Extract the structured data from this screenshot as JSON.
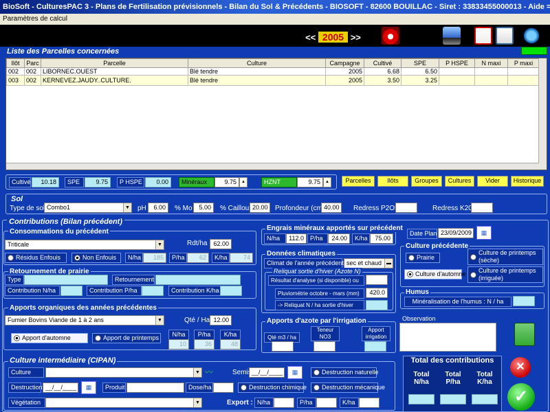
{
  "window": {
    "title": "BioSoft - CulturesPAC 3 - Plans de Fertilisation prévisionnels - Bilan du Sol & Précédents   -  BIOSOFT - 82600 BOUILLAC - Siret : 33833455000013 - Aide =..."
  },
  "menu": {
    "item": "Paramètres de calcul"
  },
  "year": {
    "prev": "<<",
    "value": "2005",
    "next": ">>"
  },
  "parcelles": {
    "title": "Liste des Parcelles concernées",
    "columns": [
      "Ilôt",
      "Parc",
      "Parcelle",
      "Culture",
      "Campagne",
      "Cultivé",
      "SPE",
      "P HSPE",
      "N maxi",
      "P maxi"
    ],
    "rows": [
      [
        "002",
        "002",
        "LIBORNEC.OUEST",
        "Blé tendre",
        "2005",
        "6.68",
        "6.50",
        "",
        "",
        ""
      ],
      [
        "003",
        "002",
        "KERNEVEZ.JAUDY..CULTURE.",
        "Blé tendre",
        "2005",
        "3.50",
        "3.25",
        "",
        "",
        ""
      ]
    ]
  },
  "totals": {
    "cultive_label": "Cultivé",
    "cultive": "10.18",
    "spe_label": "SPE",
    "spe": "9.75",
    "phspe_label": "P HSPE",
    "phspe": "0.00",
    "mineraux_label": "Minéraux",
    "mineraux": "9.75",
    "hznt_label": "HZNT",
    "hznt": "9.75"
  },
  "buttons": {
    "parcelles": "Parcelles",
    "ilots": "Ilôts",
    "groupes": "Groupes",
    "cultures": "Cultures",
    "vider": "Vider",
    "historique": "Historique"
  },
  "sol": {
    "title": "Sol",
    "type_label": "Type de sol",
    "type_value": "Combo1",
    "ph_label": "pH",
    "ph": "6.00",
    "mo_label": "% Mo",
    "mo": "5.00",
    "cailloux_label": "% Cailloux",
    "cailloux": "20.00",
    "profondeur_label": "Profondeur (cm)",
    "profondeur": "40.00",
    "redress_p_label": "Redress P2O5",
    "redress_p": "",
    "redress_k_label": "Redress K20",
    "redress_k": ""
  },
  "contributions": {
    "title": "Contributions (Bilan précédent)"
  },
  "precedent": {
    "title": "Consommations du précédent",
    "culture": "Triticale",
    "rdt_label": "Rdt/ha",
    "rdt": "62.00",
    "residus": "Résidus Enfouis",
    "non_enfouis": "Non Enfouis",
    "nha_label": "N/ha",
    "nha": "185",
    "pha_label": "P/ha",
    "pha": "62",
    "kha_label": "K/ha",
    "kha": "74"
  },
  "retournement": {
    "title": "Retournement de prairie",
    "type_label": "Type",
    "retour_label": "Retournement",
    "contrib_n": "Contribution N/ha",
    "contrib_p": "Contribution P/ha",
    "contrib_k": "Contribution K/ha"
  },
  "organiques": {
    "title": "Apports organiques des années précédentes",
    "produit": "Fumier Bovins Viande de 1 à 2 ans",
    "qte_label": "Qté / Ha",
    "qte": "12.00",
    "automne": "Apport d'automne",
    "printemps": "Apport de printemps",
    "nha_label": "N/ha",
    "nha": "10",
    "pha_label": "P/ha",
    "pha": "36",
    "kha_label": "K/ha",
    "kha": "48"
  },
  "engrais": {
    "title": "Engrais minéraux apportés sur précédent",
    "nha_label": "N/ha",
    "nha": "112.0",
    "pha_label": "P/ha",
    "pha": "24.00",
    "kha_label": "K/ha",
    "kha": "75.00"
  },
  "climat": {
    "title": "Données climatiques",
    "climat_label": "Climat de l'année précédente",
    "climat_value": "sec et chaud",
    "reliquat_title": "Reliquat sortie d'hiver (Azote N)",
    "analyse_label": "Résultat d'analyse (si disponible) ou",
    "analyse": "",
    "pluvio_label": "Pluviométrie octobre - mars (mm)",
    "pluvio": "420.0",
    "reliquat_label": "-> Reliquat N / ha sortie d'hiver",
    "reliquat": ""
  },
  "irrigation": {
    "title": "Apports d'azote par l'irrigation",
    "qte_label": "Qté m3 / ha",
    "teneur_label": "Teneur NO3",
    "apport_label": "Apport irrigation"
  },
  "dateplan": {
    "label": "Date Plan",
    "value": "23/09/2009"
  },
  "culture_precedente": {
    "title": "Culture précédente",
    "prairie": "Prairie",
    "automne": "Culture d'automne",
    "printemps_sec": "Culture de printemps (sèche)",
    "printemps_irr": "Culture de printemps (irriguée)"
  },
  "humus": {
    "title": "Humus",
    "label": "Minéralisation de l'humus : N / ha",
    "value": ""
  },
  "observation": {
    "title": "Observation"
  },
  "cipan": {
    "title": "Culture intermédiaire (CIPAN)",
    "culture_label": "Culture",
    "semis_label": "Semis",
    "semis": "__/__/____",
    "destruction_label": "Destruction",
    "destruction": "__/__/____",
    "produit_label": "Produit",
    "dose_label": "Dose/ha",
    "vegetation_label": "Végétation",
    "naturelle": "Destruction naturelle",
    "chimique": "Destruction chimique",
    "mecanique": "Destruction mécanique",
    "export_label": "Export :",
    "nha_label": "N/ha",
    "pha_label": "P/ha",
    "kha_label": "K/ha"
  },
  "total": {
    "title": "Total des contributions",
    "n": "Total N/ha",
    "p": "Total P/ha",
    "k": "Total K/ha"
  }
}
